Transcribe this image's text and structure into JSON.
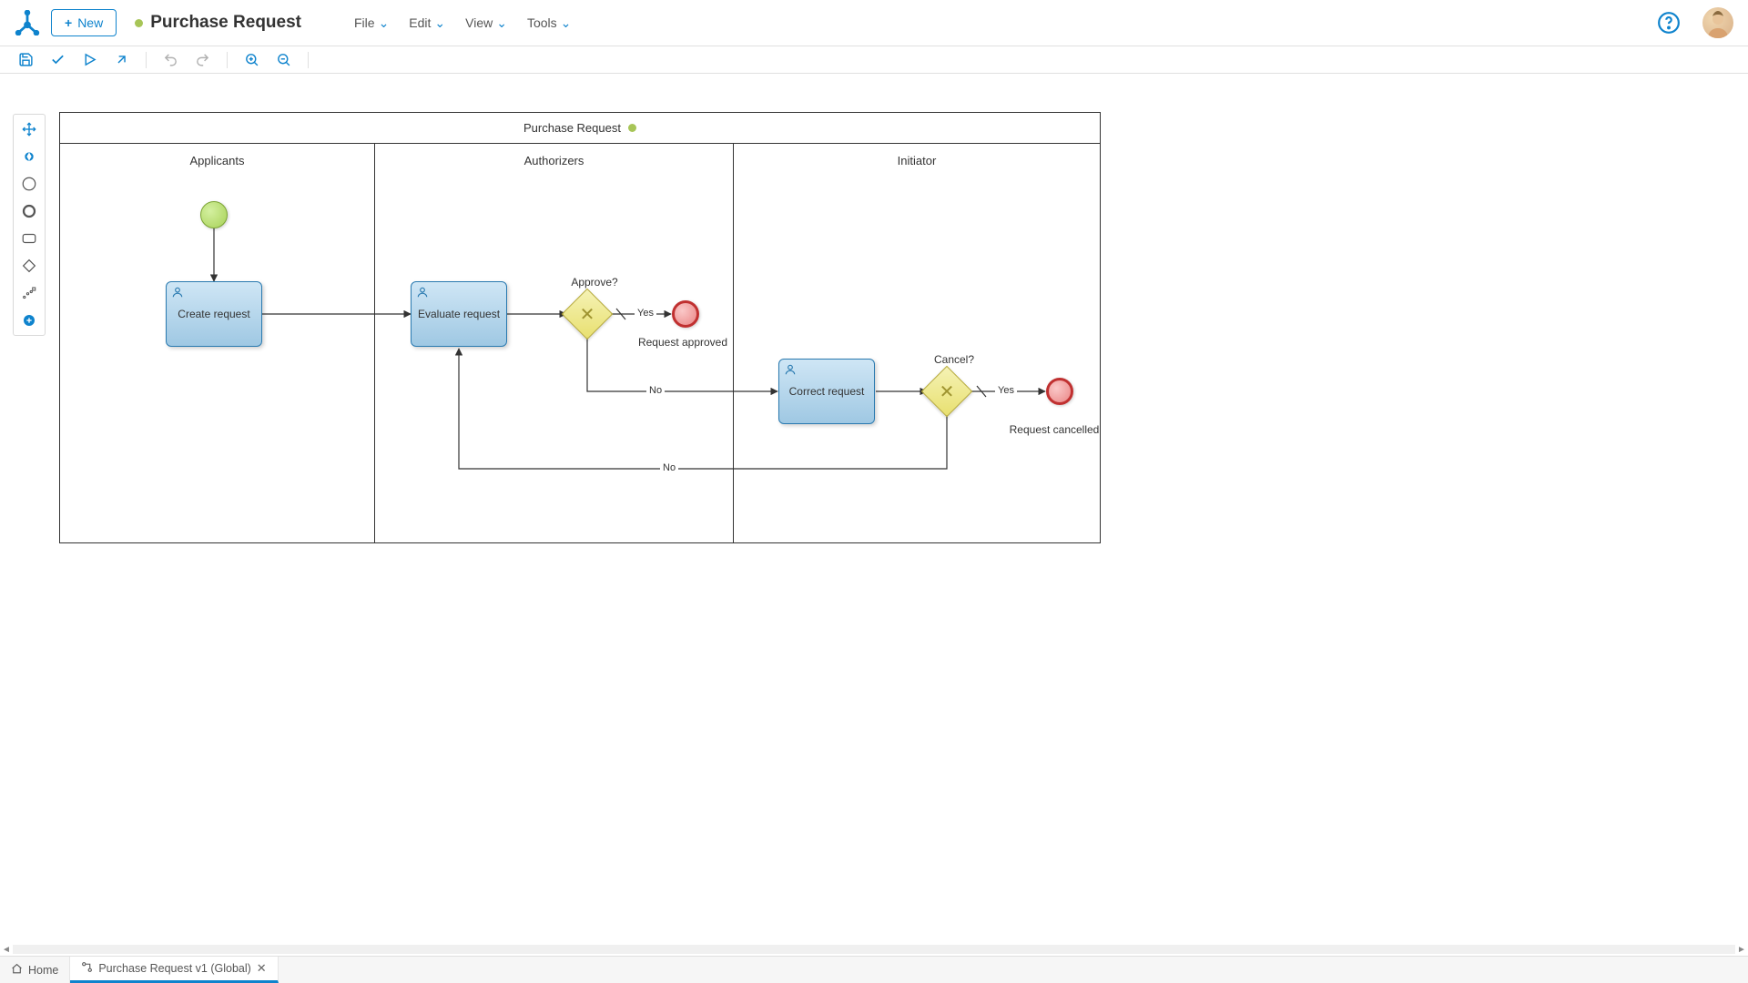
{
  "header": {
    "new_label": "New",
    "title": "Purchase Request",
    "menus": [
      "File",
      "Edit",
      "View",
      "Tools"
    ]
  },
  "toolbar_icons": [
    "save",
    "validate",
    "run",
    "export",
    "undo",
    "redo",
    "zoom-in",
    "zoom-out"
  ],
  "pool": {
    "title": "Purchase Request",
    "lanes": [
      {
        "name": "Applicants"
      },
      {
        "name": "Authorizers"
      },
      {
        "name": "Initiator"
      }
    ]
  },
  "tasks": {
    "create": "Create request",
    "evaluate": "Evaluate request",
    "correct": "Correct request"
  },
  "gateways": {
    "approve": "Approve?",
    "cancel": "Cancel?"
  },
  "flows": {
    "yes1": "Yes",
    "no1": "No",
    "yes2": "Yes",
    "no2": "No"
  },
  "events": {
    "approved": "Request approved",
    "cancelled": "Request cancelled"
  },
  "bottom": {
    "home": "Home",
    "tab1": "Purchase Request v1 (Global)"
  }
}
